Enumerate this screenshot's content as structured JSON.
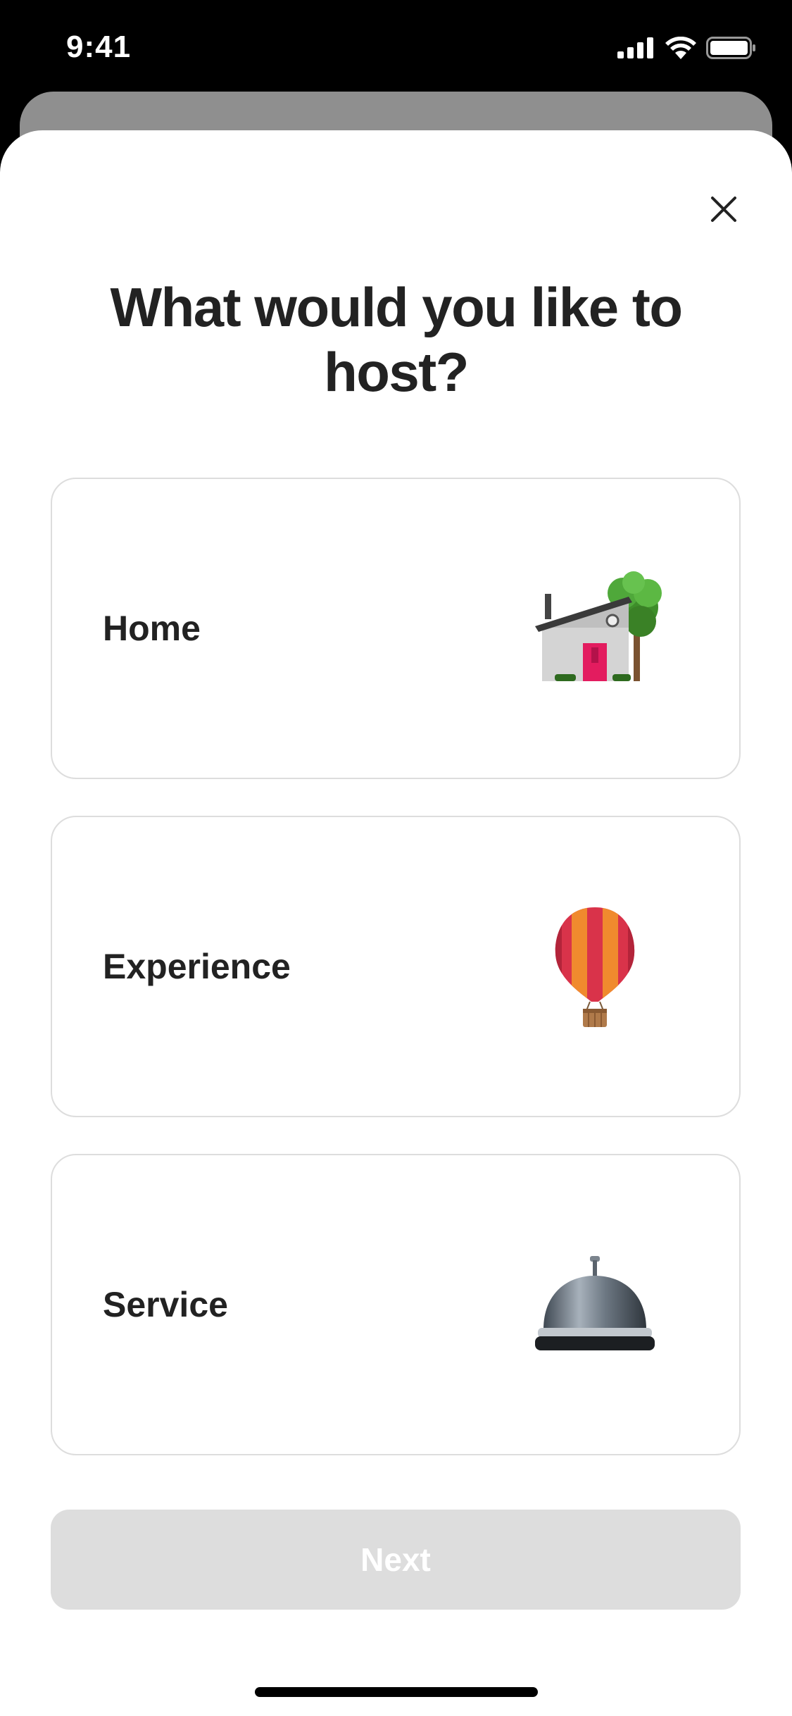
{
  "status_bar": {
    "time": "9:41"
  },
  "sheet": {
    "title": "What would you like to host?",
    "options": [
      {
        "label": "Home",
        "icon": "house-icon"
      },
      {
        "label": "Experience",
        "icon": "hot-air-balloon-icon"
      },
      {
        "label": "Service",
        "icon": "service-bell-icon"
      }
    ],
    "next_label": "Next"
  },
  "colors": {
    "card_border": "#dddddd",
    "next_disabled_bg": "#dddddd",
    "text": "#222222",
    "door": "#e31c5f"
  }
}
